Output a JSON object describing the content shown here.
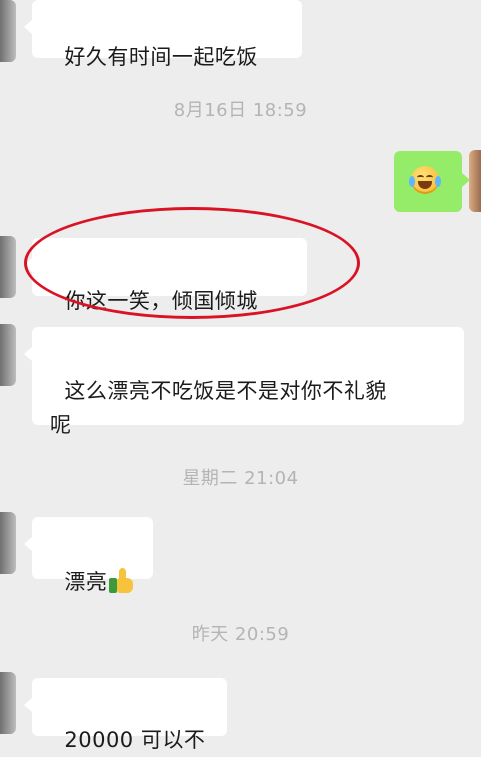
{
  "messages": [
    {
      "text": "好久有时间一起吃饭"
    },
    {
      "timestamp": "8月16日 18:59"
    },
    {
      "emoji": "laughing-crying-emoji"
    },
    {
      "text": "你这一笑，倾国倾城"
    },
    {
      "text": "这么漂亮不吃饭是不是对你不礼貌\n呢"
    },
    {
      "timestamp": "星期二 21:04"
    },
    {
      "text": "漂亮",
      "emoji": "thumbs-up-emoji"
    },
    {
      "timestamp": "昨天 20:59"
    },
    {
      "text": "20000 可以不"
    }
  ],
  "colors": {
    "background": "#ededed",
    "received_bubble": "#ffffff",
    "sent_bubble": "#95ec69",
    "timestamp": "#b4b4b4",
    "annotation": "#d91324"
  }
}
